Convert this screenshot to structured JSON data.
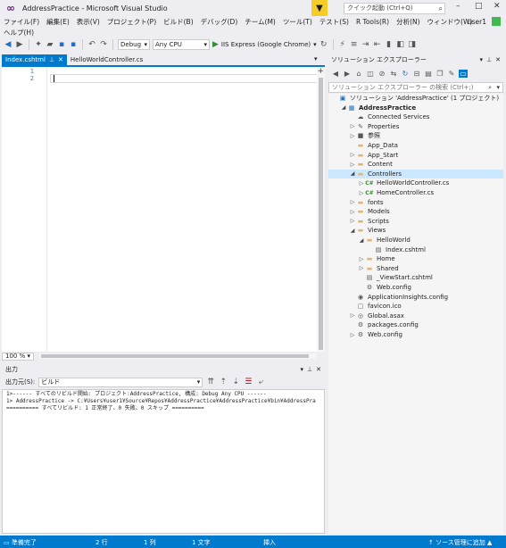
{
  "window": {
    "title": "AddressPractice - Microsoft Visual Studio",
    "quick_launch_placeholder": "クイック起動 (Ctrl+Q)",
    "user": "user1"
  },
  "menu": {
    "row1": [
      "ファイル(F)",
      "編集(E)",
      "表示(V)",
      "プロジェクト(P)",
      "ビルド(B)",
      "デバッグ(D)",
      "チーム(M)",
      "ツール(T)",
      "テスト(S)",
      "R Tools(R)",
      "分析(N)",
      "ウィンドウ(W)"
    ],
    "row2": [
      "ヘルプ(H)"
    ]
  },
  "toolbar": {
    "configuration": "Debug",
    "platform": "Any CPU",
    "run_label": "IIS Express (Google Chrome)"
  },
  "editor": {
    "tabs": [
      {
        "label": "Index.cshtml",
        "active": true
      },
      {
        "label": "HelloWorldController.cs",
        "active": false
      }
    ],
    "line_numbers": [
      "1",
      "2"
    ],
    "zoom": "100 %"
  },
  "output": {
    "title": "出力",
    "source_label": "出力元(S):",
    "source_value": "ビルド",
    "lines": [
      "1>------ すべてのリビルド開始: プロジェクト:AddressPractice, 構成: Debug Any CPU ------",
      "1>  AddressPractice -> C:¥Users¥user1¥Source¥Repos¥AddressPractice¥AddressPractice¥bin¥AddressPra",
      "========== すべてリビルド: 1 正常終了、0 失敗、0 スキップ =========="
    ]
  },
  "solution_explorer": {
    "title": "ソリューション エクスプローラー",
    "search_placeholder": "ソリューション エクスプローラー の検索 (Ctrl+;)",
    "items": [
      {
        "label": "ソリューション 'AddressPractice' (1 プロジェクト)",
        "indent": 0,
        "expander": "",
        "icon": "solution-icon",
        "glyph": "▣",
        "kind": "proj",
        "bold": false,
        "selected": false
      },
      {
        "label": "AddressPractice",
        "indent": 1,
        "expander": "◢",
        "icon": "web-project-icon",
        "glyph": "▦",
        "kind": "proj",
        "bold": true,
        "selected": false
      },
      {
        "label": "Connected Services",
        "indent": 2,
        "expander": "",
        "icon": "connected-services-icon",
        "glyph": "☁",
        "kind": "gray",
        "bold": false,
        "selected": false
      },
      {
        "label": "Properties",
        "indent": 2,
        "expander": "▷",
        "icon": "wrench-icon",
        "glyph": "✎",
        "kind": "gray",
        "bold": false,
        "selected": false
      },
      {
        "label": "参照",
        "indent": 2,
        "expander": "▷",
        "icon": "references-icon",
        "glyph": "■",
        "kind": "gray",
        "bold": false,
        "selected": false
      },
      {
        "label": "App_Data",
        "indent": 2,
        "expander": "",
        "icon": "folder-icon",
        "glyph": "▬",
        "kind": "folder",
        "bold": false,
        "selected": false
      },
      {
        "label": "App_Start",
        "indent": 2,
        "expander": "▷",
        "icon": "folder-icon",
        "glyph": "▬",
        "kind": "folder",
        "bold": false,
        "selected": false
      },
      {
        "label": "Content",
        "indent": 2,
        "expander": "▷",
        "icon": "folder-icon",
        "glyph": "▬",
        "kind": "folder",
        "bold": false,
        "selected": false
      },
      {
        "label": "Controllers",
        "indent": 2,
        "expander": "◢",
        "icon": "folder-open-icon",
        "glyph": "▬",
        "kind": "folder",
        "bold": false,
        "selected": true
      },
      {
        "label": "HelloWorldController.cs",
        "indent": 3,
        "expander": "▷",
        "icon": "csharp-file-icon",
        "glyph": "C#",
        "kind": "cs",
        "bold": false,
        "selected": false
      },
      {
        "label": "HomeController.cs",
        "indent": 3,
        "expander": "▷",
        "icon": "csharp-file-icon",
        "glyph": "C#",
        "kind": "cs",
        "bold": false,
        "selected": false
      },
      {
        "label": "fonts",
        "indent": 2,
        "expander": "▷",
        "icon": "folder-icon",
        "glyph": "▬",
        "kind": "folder",
        "bold": false,
        "selected": false
      },
      {
        "label": "Models",
        "indent": 2,
        "expander": "▷",
        "icon": "folder-icon",
        "glyph": "▬",
        "kind": "folder",
        "bold": false,
        "selected": false
      },
      {
        "label": "Scripts",
        "indent": 2,
        "expander": "▷",
        "icon": "folder-icon",
        "glyph": "▬",
        "kind": "folder",
        "bold": false,
        "selected": false
      },
      {
        "label": "Views",
        "indent": 2,
        "expander": "◢",
        "icon": "folder-open-icon",
        "glyph": "▬",
        "kind": "folder",
        "bold": false,
        "selected": false
      },
      {
        "label": "HelloWorld",
        "indent": 3,
        "expander": "◢",
        "icon": "folder-open-icon",
        "glyph": "▬",
        "kind": "folder",
        "bold": false,
        "selected": false
      },
      {
        "label": "Index.cshtml",
        "indent": 4,
        "expander": "",
        "icon": "razor-file-icon",
        "glyph": "▤",
        "kind": "gray",
        "bold": false,
        "selected": false
      },
      {
        "label": "Home",
        "indent": 3,
        "expander": "▷",
        "icon": "folder-icon",
        "glyph": "▬",
        "kind": "folder",
        "bold": false,
        "selected": false
      },
      {
        "label": "Shared",
        "indent": 3,
        "expander": "▷",
        "icon": "folder-icon",
        "glyph": "▬",
        "kind": "folder",
        "bold": false,
        "selected": false
      },
      {
        "label": "_ViewStart.cshtml",
        "indent": 3,
        "expander": "",
        "icon": "razor-file-icon",
        "glyph": "▤",
        "kind": "gray",
        "bold": false,
        "selected": false
      },
      {
        "label": "Web.config",
        "indent": 3,
        "expander": "",
        "icon": "config-file-icon",
        "glyph": "⚙",
        "kind": "gray",
        "bold": false,
        "selected": false
      },
      {
        "label": "ApplicationInsights.config",
        "indent": 2,
        "expander": "",
        "icon": "insights-config-icon",
        "glyph": "◉",
        "kind": "gray",
        "bold": false,
        "selected": false
      },
      {
        "label": "favicon.ico",
        "indent": 2,
        "expander": "",
        "icon": "image-file-icon",
        "glyph": "▢",
        "kind": "gray",
        "bold": false,
        "selected": false
      },
      {
        "label": "Global.asax",
        "indent": 2,
        "expander": "▷",
        "icon": "global-asax-icon",
        "glyph": "◎",
        "kind": "gray",
        "bold": false,
        "selected": false
      },
      {
        "label": "packages.config",
        "indent": 2,
        "expander": "",
        "icon": "config-file-icon",
        "glyph": "⚙",
        "kind": "gray",
        "bold": false,
        "selected": false
      },
      {
        "label": "Web.config",
        "indent": 2,
        "expander": "▷",
        "icon": "config-file-icon",
        "glyph": "⚙",
        "kind": "gray",
        "bold": false,
        "selected": false
      }
    ]
  },
  "status": {
    "ready": "準備完了",
    "line": "2 行",
    "col": "1 列",
    "ch": "1 文字",
    "mode": "挿入",
    "source_control": "↑ ソース管理に追加 ▲"
  },
  "colors": {
    "accent": "#007acc",
    "filter_badge": "#f5cc28",
    "selection": "#cce8ff"
  }
}
